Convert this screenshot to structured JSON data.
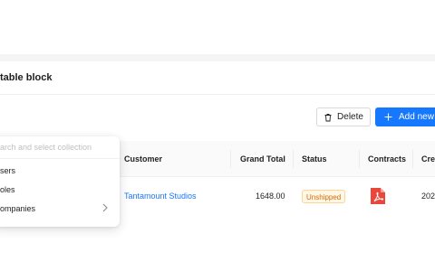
{
  "block": {
    "title": "table block"
  },
  "toolbar": {
    "delete_label": "Delete",
    "add_label": "Add new"
  },
  "collection_dropdown": {
    "search_placeholder": "arch and select collection",
    "items": [
      {
        "label": "sers",
        "has_submenu": false
      },
      {
        "label": "oles",
        "has_submenu": false
      },
      {
        "label": "ompanies",
        "has_submenu": true
      }
    ]
  },
  "table": {
    "columns": [
      "Customer",
      "Grand Total",
      "Status",
      "Contracts",
      "Cre"
    ],
    "rows": [
      {
        "customer": "Tantamount Studios",
        "grand_total": "1648.00",
        "status": "Unshipped",
        "contracts": "pdf-file-icon",
        "created": "202"
      }
    ]
  },
  "colors": {
    "primary": "#1677ff",
    "status_bg": "#fff7e6",
    "status_text": "#d46b08"
  }
}
